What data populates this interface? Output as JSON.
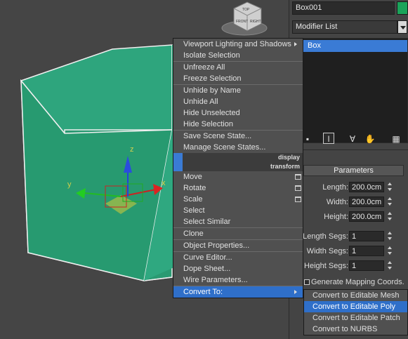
{
  "viewport": {
    "viewcube_labels": [
      "TOP",
      "FRONT",
      "RIGHT"
    ],
    "axes": {
      "x": "x",
      "y": "y",
      "z": "z"
    }
  },
  "command_panel": {
    "object_name": "Box001",
    "object_color": "#1aa45a",
    "modifier_list": "Modifier List",
    "stack_item": "Box",
    "rollout_title": "Parameters",
    "params": [
      {
        "label": "Length:",
        "value": "200.0cm"
      },
      {
        "label": "Width:",
        "value": "200.0cm"
      },
      {
        "label": "Height:",
        "value": "200.0cm"
      },
      {
        "label": "Length Segs:",
        "value": "1"
      },
      {
        "label": "Width Segs:",
        "value": "1"
      },
      {
        "label": "Height Segs:",
        "value": "1"
      }
    ],
    "gen_mapping": "Generate Mapping Coords."
  },
  "quad_menu": {
    "group1": [
      "Viewport Lighting and Shadows",
      "Isolate Selection"
    ],
    "group2": [
      "Unfreeze All",
      "Freeze Selection"
    ],
    "group3": [
      "Unhide by Name",
      "Unhide All",
      "Hide Unselected",
      "Hide Selection"
    ],
    "group4": [
      "Save Scene State...",
      "Manage Scene States..."
    ],
    "title_display": "display",
    "title_transform": "transform",
    "group5": [
      "Move",
      "Rotate",
      "Scale",
      "Select",
      "Select Similar"
    ],
    "group6": [
      "Clone"
    ],
    "group7": [
      "Object Properties..."
    ],
    "group8": [
      "Curve Editor...",
      "Dope Sheet...",
      "Wire Parameters..."
    ],
    "group9": [
      "Convert To:"
    ]
  },
  "submenu": [
    "Convert to Editable Mesh",
    "Convert to Editable Poly",
    "Convert to Editable Patch",
    "Convert to NURBS"
  ]
}
